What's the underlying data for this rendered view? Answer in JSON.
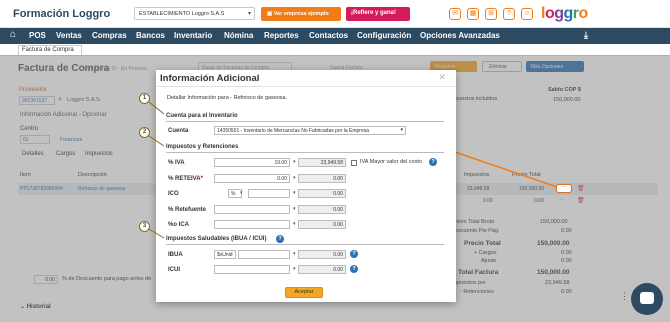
{
  "header": {
    "brand": "Formación Loggro",
    "company_select": "ESTABLECIMIENTO Loggro S.A.S",
    "btn_example": "Ver empresa ejemplo",
    "btn_refer": "¡Refiere y gana!",
    "logo": "loggro",
    "accent": "#f07d18",
    "pink": "#d31b5e",
    "nav_color": "#2d4a63"
  },
  "nav": {
    "items": [
      "POS",
      "Ventas",
      "Compras",
      "Bancos",
      "Inventario",
      "Nómina",
      "Reportes",
      "Contactos",
      "Configuración",
      "Opciones Avanzadas"
    ]
  },
  "tab": {
    "label": "Factura de Compra"
  },
  "page": {
    "title": "Factura de Compra",
    "subtitle": "(Nro. PROV-5) - En Proceso",
    "import_link": "Basar en Facturas de Compra",
    "new_invoice": "Nueva Factura",
    "btn_register": "Registrar",
    "btn_delete": "Eliminar",
    "btn_more": "Más Opciones",
    "provider_label": "Proveedor",
    "provider_id": "901361537",
    "provider_name": "Loggro S.A.S.",
    "additional_info": "Información Adicional - Opcional",
    "center_label": "Centro",
    "center_code": "01",
    "center_name": "Finanzas",
    "tabs": [
      "Detalles",
      "Cargos",
      "Impuestos"
    ],
    "col_item": "Ítem",
    "col_desc": "Descripción",
    "col_taxes": "Impuestos",
    "col_price": "Precio Total",
    "row_item": "PP1738783986994",
    "row_desc": "Refresco de gaseosa.",
    "row_taxes": "23,949.58",
    "row_price": "150,000.00",
    "row2_taxes": "0.00",
    "row2_price": "0.00",
    "currency_label": "Saldo COP $",
    "balance": "150,000.00",
    "taxes_included": "Impuestos incluidos",
    "discount_value": "0.00",
    "discount_label": "% de Descuento para pago antes de",
    "history": "Historial",
    "totals": [
      {
        "label": "Precio Total Bruto",
        "value": "150,000.00"
      },
      {
        "label": "Descuento Pie Pág.",
        "value": "0.00"
      },
      {
        "label": "Precio Total",
        "value": "150,000.00"
      },
      {
        "label": "+ Cargos",
        "value": "0.00"
      },
      {
        "label": "Ajuste",
        "value": "0.00"
      },
      {
        "label": "Total Factura",
        "value": "150,000.00"
      },
      {
        "label": "Impuestos por",
        "value": "23,949.58"
      },
      {
        "label": "- Retenciones",
        "value": "0.00"
      }
    ]
  },
  "modal": {
    "title": "Información Adicional",
    "description": "Detallar Información para - Refresco de gaseosa.",
    "section_inventory": "Cuenta para el Inventario",
    "account_label": "Cuenta",
    "account_value": "14350501 - Inventario de Mercancías No Fabricadas por la Empresa",
    "section_taxes": "Impuestos y Retenciones",
    "iva_label": "% IVA",
    "iva_rate": "19.00",
    "iva_amount": "23,949.58",
    "iva_check_label": "IVA Mayor valor del costo",
    "reteiva_label": "% RETEIVA",
    "reteiva_rate": "0.00",
    "reteiva_amount": "0.00",
    "ico_label": "ICO",
    "ico_unit": "%",
    "ico_amount": "0.00",
    "retefuente_label": "% Retefuente",
    "retefuente_amount": "0.00",
    "ica_label": "%o ICA",
    "ica_amount": "0.00",
    "section_healthy": "Impuestos Saludables (IBUA / ICUI)",
    "ibua_label": "IBUA",
    "ibua_unit": "$xUnid",
    "ibua_amount": "0.00",
    "icui_label": "ICUI",
    "icui_amount": "0.00",
    "accept": "Aceptar",
    "markers": [
      "1",
      "2",
      "3"
    ]
  }
}
